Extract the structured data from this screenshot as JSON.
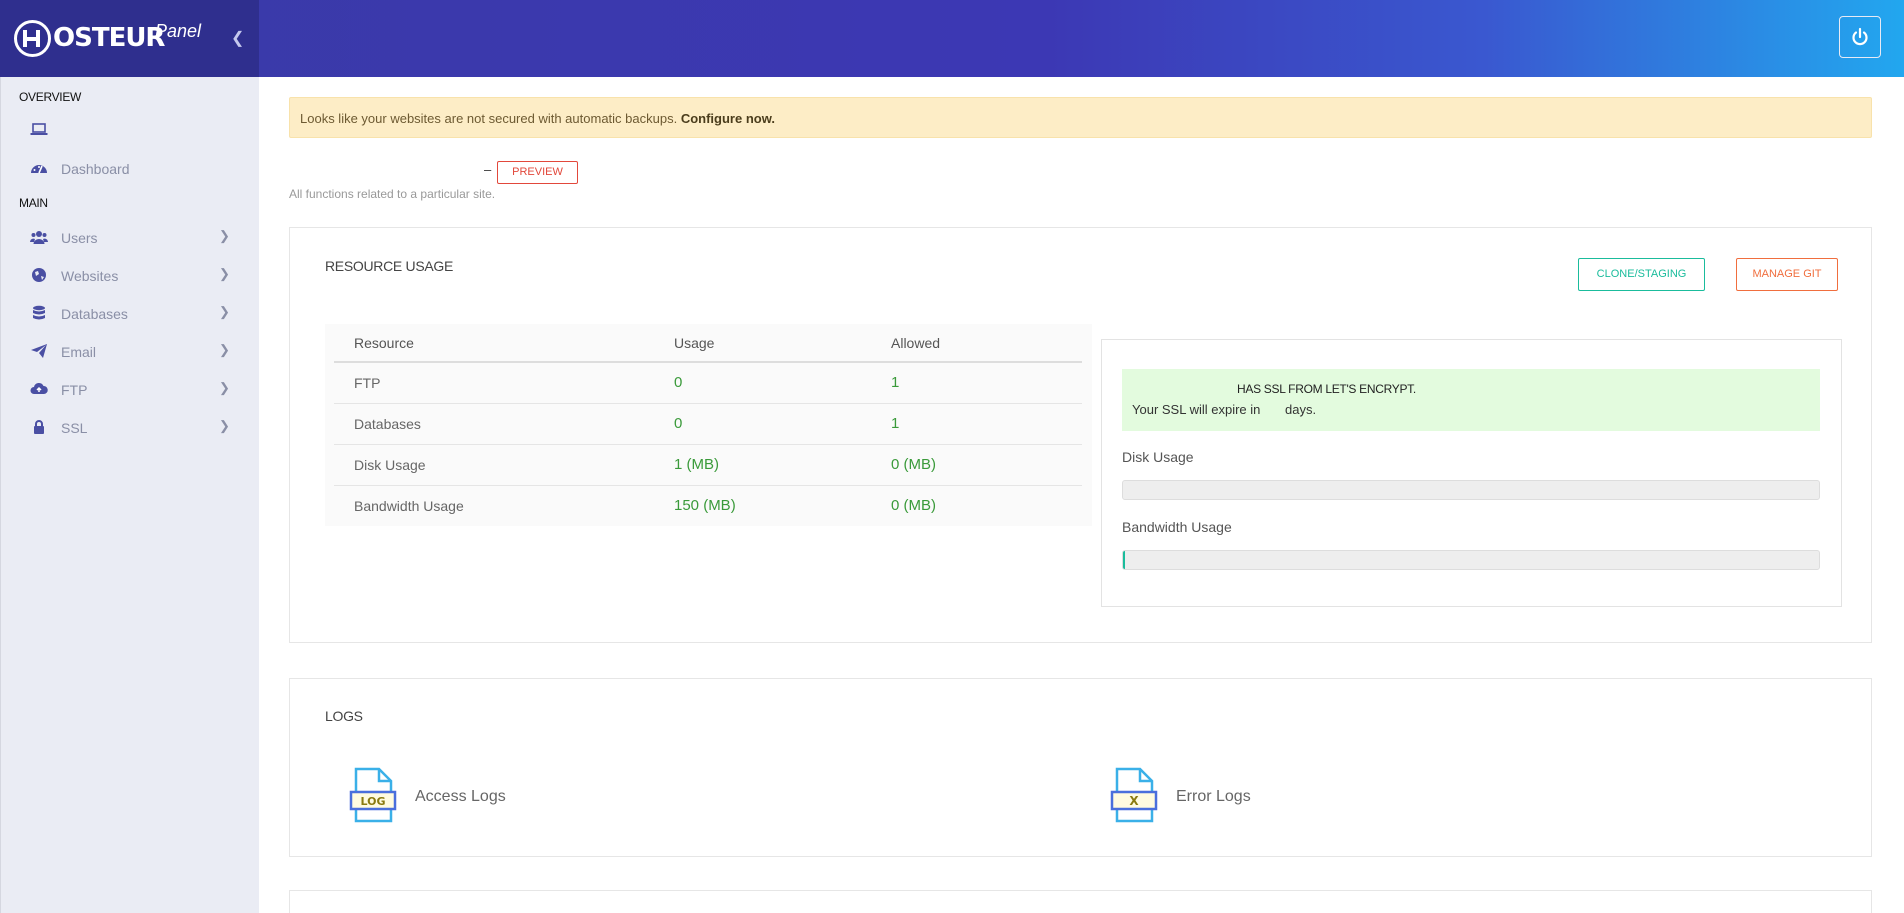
{
  "brand": {
    "name": "OSTEUR",
    "suffix": "Panel"
  },
  "sidebar": {
    "overview_heading": "OVERVIEW",
    "main_heading": "MAIN",
    "overview_items": [
      {
        "label": "",
        "icon": "laptop-icon"
      },
      {
        "label": "Dashboard",
        "icon": "dashboard-icon"
      }
    ],
    "main_items": [
      {
        "label": "Users",
        "icon": "users-icon"
      },
      {
        "label": "Websites",
        "icon": "globe-icon"
      },
      {
        "label": "Databases",
        "icon": "database-icon"
      },
      {
        "label": "Email",
        "icon": "paper-plane-icon"
      },
      {
        "label": "FTP",
        "icon": "cloud-upload-icon"
      },
      {
        "label": "SSL",
        "icon": "lock-icon"
      }
    ]
  },
  "alert": {
    "text": "Looks like your websites are not secured with automatic backups.",
    "link": "Configure now."
  },
  "site": {
    "dash": "–",
    "preview_label": "PREVIEW",
    "subtitle": "All functions related to a particular site."
  },
  "resource_usage": {
    "title": "RESOURCE USAGE",
    "clone_label": "CLONE/STAGING",
    "git_label": "MANAGE GIT",
    "headers": [
      "Resource",
      "Usage",
      "Allowed"
    ],
    "rows": [
      {
        "resource": "FTP",
        "usage": "0",
        "allowed": "1"
      },
      {
        "resource": "Databases",
        "usage": "0",
        "allowed": "1"
      },
      {
        "resource": "Disk Usage",
        "usage": "1 (MB)",
        "allowed": "0 (MB)"
      },
      {
        "resource": "Bandwidth Usage",
        "usage": "150 (MB)",
        "allowed": "0 (MB)"
      }
    ],
    "ssl": {
      "line1": "HAS SSL FROM LET'S ENCRYPT.",
      "line2": "Your SSL will expire in",
      "days": "days."
    },
    "disk_label": "Disk Usage",
    "disk_fraction": 0,
    "bandwidth_label": "Bandwidth Usage",
    "bandwidth_fraction": 0.003,
    "accent": "#1abc9c"
  },
  "logs": {
    "title": "LOGS",
    "access": {
      "label": "Access Logs",
      "badge": "LOG"
    },
    "error": {
      "label": "Error Logs",
      "badge": "X"
    }
  }
}
